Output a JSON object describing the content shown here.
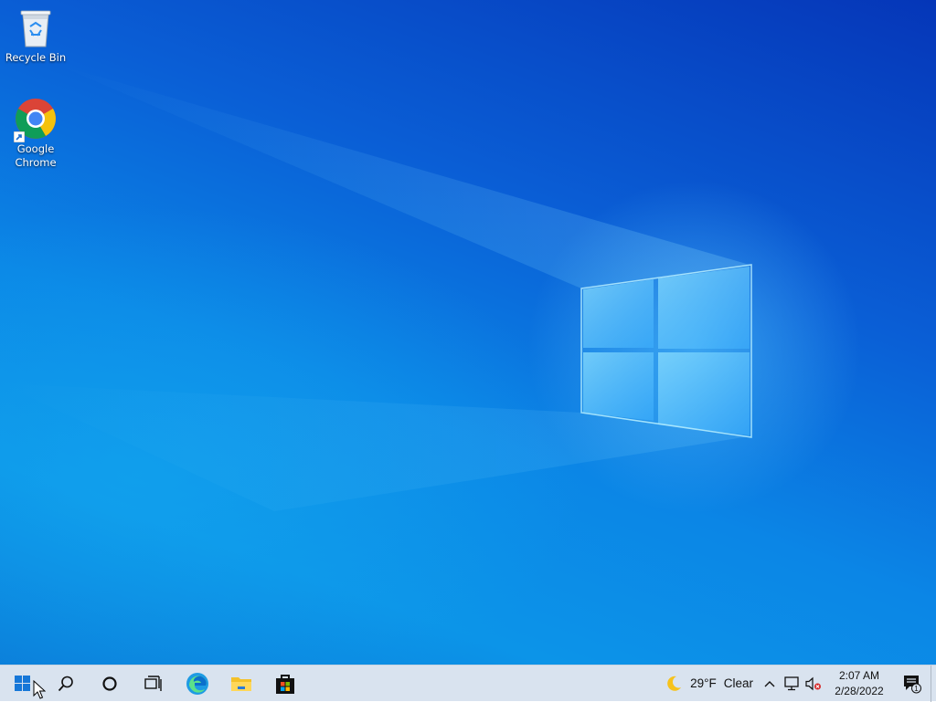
{
  "desktop": {
    "icons": [
      {
        "label": "Recycle Bin",
        "icon": "recycle-bin-icon"
      },
      {
        "label": "Google Chrome",
        "icon": "chrome-icon"
      }
    ]
  },
  "taskbar": {
    "pinned": [
      {
        "name": "start",
        "icon": "windows-logo-icon"
      },
      {
        "name": "search",
        "icon": "search-icon"
      },
      {
        "name": "cortana",
        "icon": "cortana-icon"
      },
      {
        "name": "task-view",
        "icon": "task-view-icon"
      },
      {
        "name": "edge",
        "icon": "edge-icon"
      },
      {
        "name": "file-explorer",
        "icon": "folder-icon"
      },
      {
        "name": "store",
        "icon": "store-icon"
      }
    ],
    "weather": {
      "icon": "moon-icon",
      "temperature": "29°F",
      "condition": "Clear"
    },
    "tray": {
      "icons": [
        "chevron-up-icon",
        "network-icon",
        "volume-muted-icon"
      ]
    },
    "clock": {
      "time": "2:07 AM",
      "date": "2/28/2022"
    },
    "notifications": {
      "icon": "action-center-icon",
      "count": "1"
    }
  },
  "colors": {
    "taskbar_bg": "#d9e3ef",
    "desktop_blue": "#0a7ad8",
    "edge_accent": "#1fa0e0",
    "folder_yellow": "#f4c12a"
  }
}
